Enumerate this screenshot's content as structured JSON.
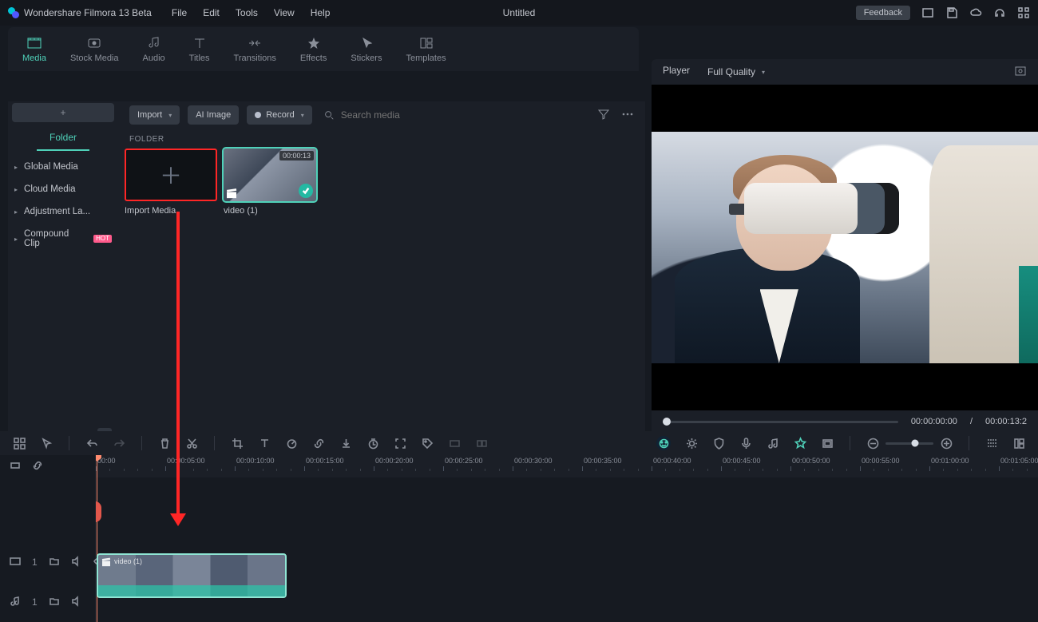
{
  "app": {
    "name": "Wondershare Filmora 13 Beta",
    "document": "Untitled",
    "feedback": "Feedback"
  },
  "menus": [
    "File",
    "Edit",
    "Tools",
    "View",
    "Help"
  ],
  "titlebar_icons": [
    "window-icon",
    "save-icon",
    "cloud-icon",
    "headset-icon",
    "apps-icon"
  ],
  "toptabs": [
    {
      "id": "media",
      "label": "Media",
      "active": true,
      "icon": "media-icon"
    },
    {
      "id": "stock",
      "label": "Stock Media",
      "icon": "stock-icon"
    },
    {
      "id": "audio",
      "label": "Audio",
      "icon": "music-icon"
    },
    {
      "id": "titles",
      "label": "Titles",
      "icon": "text-icon"
    },
    {
      "id": "transitions",
      "label": "Transitions",
      "icon": "transition-icon"
    },
    {
      "id": "effects",
      "label": "Effects",
      "icon": "effects-icon"
    },
    {
      "id": "stickers",
      "label": "Stickers",
      "icon": "sticker-icon"
    },
    {
      "id": "templates",
      "label": "Templates",
      "icon": "templates-icon"
    }
  ],
  "mediabar": {
    "import": "Import",
    "ai_image": "AI Image",
    "record": "Record",
    "search_placeholder": "Search media",
    "filter": "filter-icon",
    "more": "more-icon"
  },
  "sidebar": {
    "folder_tab": "Folder",
    "items": [
      {
        "label": "Global Media"
      },
      {
        "label": "Cloud Media"
      },
      {
        "label": "Adjustment La..."
      },
      {
        "label": "Compound Clip",
        "badge": "HOT"
      }
    ]
  },
  "section": {
    "folder": "FOLDER"
  },
  "thumbs": {
    "import": {
      "label": "Import Media"
    },
    "clip": {
      "label": "video (1)",
      "duration": "00:00:13"
    }
  },
  "player": {
    "tab": "Player",
    "quality": "Full Quality",
    "time_cur": "00:00:00:00",
    "time_sep": "/",
    "time_dur": "00:00:13:2",
    "ctrls": [
      "prev-frame",
      "play-pause-icon",
      "play-icon",
      "stop-icon"
    ],
    "right": [
      "mark-in-icon",
      "mark-out-icon",
      "ratio-icon",
      "chev-icon",
      "display-icon",
      "snapshot-icon",
      "volume-icon",
      "expand-icon"
    ],
    "top_snap": "snapshot"
  },
  "tl_tools": {
    "left": [
      "grid-icon",
      "pointer-icon",
      "undo-icon",
      "redo-icon",
      "delete-icon",
      "cut-icon",
      "crop-icon",
      "text-tool-icon",
      "speed-icon",
      "link-icon",
      "download-icon",
      "timer-icon",
      "fit-icon",
      "tag-icon",
      "clip-icon",
      "group-icon"
    ],
    "right": [
      "ai-spark-icon",
      "enhance-icon",
      "shield-icon",
      "mic-icon",
      "music-tool-icon",
      "smart-icon",
      "frame-icon"
    ],
    "zoom": [
      "zoom-out-icon",
      "zoom-in-icon"
    ],
    "far": [
      "layout-icon",
      "layout2-icon"
    ]
  },
  "tl_header": {
    "snap": "snap-icon",
    "link": "link2-icon"
  },
  "tl_tracks": {
    "video": {
      "id": "1",
      "icons": [
        "folder-sm-icon",
        "mute-icon",
        "eye-icon"
      ],
      "clip_name": "video (1)"
    },
    "audio": {
      "id": "1",
      "icons": [
        "folder-sm-icon",
        "mute-icon"
      ]
    }
  },
  "ruler": [
    "00:00",
    "00:00:05:00",
    "00:00:10:00",
    "00:00:15:00",
    "00:00:20:00",
    "00:00:25:00",
    "00:00:30:00",
    "00:00:35:00",
    "00:00:40:00",
    "00:00:45:00",
    "00:00:50:00",
    "00:00:55:00",
    "00:01:00:00",
    "00:01:05:00"
  ]
}
